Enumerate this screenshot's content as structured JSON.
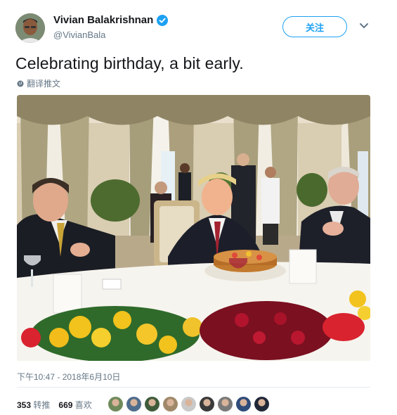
{
  "user": {
    "display_name": "Vivian Balakrishnan",
    "handle": "@VivianBala",
    "verified": true
  },
  "follow_button_label": "关注",
  "tweet": {
    "text": "Celebrating birthday, a bit early.",
    "translate_label": "翻译推文",
    "timestamp": "下午10:47 - 2018年6月10日"
  },
  "stats": {
    "retweets_count": "353",
    "retweets_label": "转推",
    "likes_count": "669",
    "likes_label": "喜欢"
  },
  "likers": [
    {
      "icon": "liker-avatar-1",
      "color": "#6f8a5a"
    },
    {
      "icon": "liker-avatar-2",
      "color": "#4f6d8c"
    },
    {
      "icon": "liker-avatar-3",
      "color": "#3f5c3a"
    },
    {
      "icon": "liker-avatar-4",
      "color": "#a0896a"
    },
    {
      "icon": "liker-avatar-5",
      "color": "#c9c9c9"
    },
    {
      "icon": "liker-avatar-6",
      "color": "#3a3a3a"
    },
    {
      "icon": "liker-avatar-7",
      "color": "#7a7a7a"
    },
    {
      "icon": "liker-avatar-8",
      "color": "#2f4c7a"
    },
    {
      "icon": "liker-avatar-9",
      "color": "#202838"
    }
  ],
  "colors": {
    "accent": "#1da1f2",
    "muted": "#657786",
    "text": "#14171a"
  }
}
